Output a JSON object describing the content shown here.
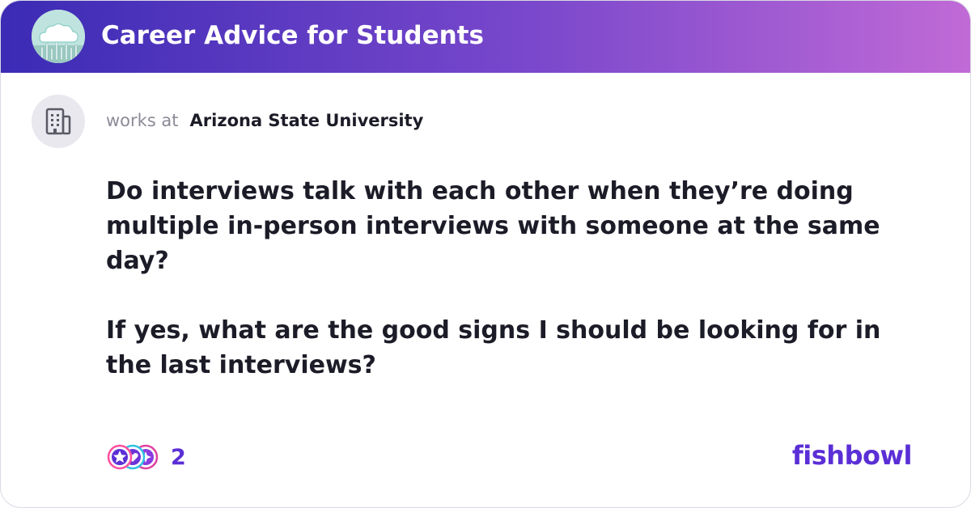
{
  "header": {
    "bowl_title": "Career Advice for Students",
    "bowl_icon": "cloud-icon",
    "gradient": [
      "#3b2bb5",
      "#c06ad6"
    ]
  },
  "author": {
    "works_label": "works at",
    "company": "Arizona State University",
    "company_icon": "building-icon"
  },
  "post": {
    "question": "Do interviews talk with each other when they’re doing multiple in-person interviews with someone at the same day?",
    "followup": "If yes, what are the good signs I should be looking for in the last interviews?"
  },
  "footer": {
    "reaction_icons": [
      "star-reaction-icon",
      "heart-reaction-icon",
      "sparkle-reaction-icon"
    ],
    "reaction_count": "2",
    "logo": "fishbowl",
    "accent": "#5b2fd6"
  }
}
